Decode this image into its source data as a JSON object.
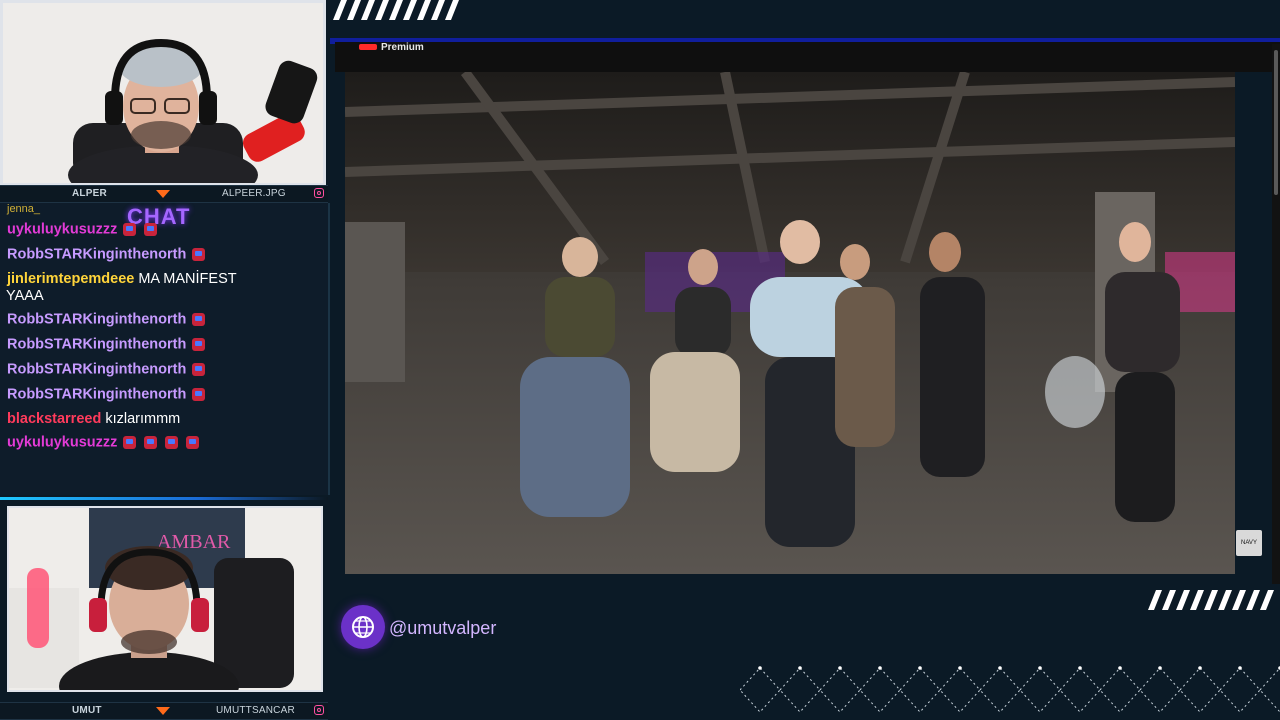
{
  "cams": {
    "top": {
      "name_left": "ALPER",
      "name_right": "ALPEER.JPG"
    },
    "bottom": {
      "name_left": "UMUT",
      "name_right": "UMUTTSANCAR",
      "poster_text": "AMBAR"
    }
  },
  "chat": {
    "title": "CHAT",
    "partial_top": "jenna_",
    "messages": [
      {
        "user": "uykuluykusuzzz",
        "text": "",
        "color": "#e23bd6",
        "badges": 2
      },
      {
        "user": "RobbSTARKinginthenorth",
        "text": "",
        "color": "#c79bff",
        "badges": 1
      },
      {
        "user": "jinlerimtepemdeee",
        "text": "MA MANİFEST",
        "color": "#ffd43a",
        "badges": 0,
        "cont": "YAAA"
      },
      {
        "user": "RobbSTARKinginthenorth",
        "text": "",
        "color": "#c79bff",
        "badges": 1
      },
      {
        "user": "RobbSTARKinginthenorth",
        "text": "",
        "color": "#c79bff",
        "badges": 1
      },
      {
        "user": "RobbSTARKinginthenorth",
        "text": "",
        "color": "#c79bff",
        "badges": 1
      },
      {
        "user": "RobbSTARKinginthenorth",
        "text": "",
        "color": "#c79bff",
        "badges": 1
      },
      {
        "user": "blackstarreed",
        "text": "kızlarımmm",
        "color": "#ff3b5c",
        "badges": 0
      },
      {
        "user": "uykuluykusuzzz",
        "text": "",
        "color": "#e23bd6",
        "badges": 4
      }
    ]
  },
  "browser": {
    "tab_label": "Premium"
  },
  "video": {
    "watermark": "NAVY"
  },
  "social": {
    "icon": "globe-icon",
    "handle": "@umutvalper"
  },
  "colors": {
    "accent_blue": "#101e9c",
    "purple": "#6b31c8",
    "orange": "#ff6a1a"
  }
}
